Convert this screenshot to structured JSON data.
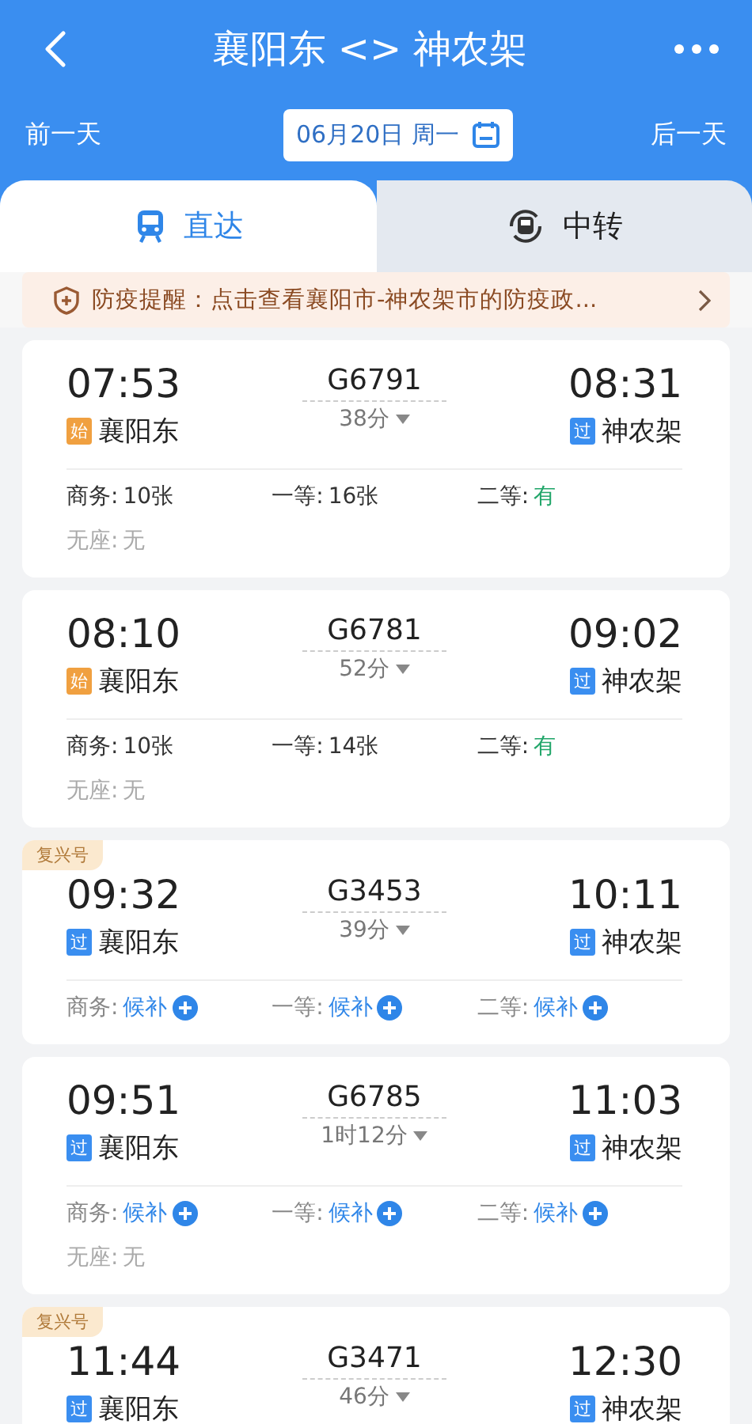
{
  "header": {
    "title": "襄阳东 <> 神农架",
    "prev_day": "前一天",
    "date": "06月20日 周一",
    "next_day": "后一天"
  },
  "tabs": [
    {
      "label": "直达",
      "kind": "direct",
      "selected": true
    },
    {
      "label": "中转",
      "kind": "transfer",
      "selected": false
    }
  ],
  "notice": {
    "text": "防疫提醒：点击查看襄阳市-神农架市的防疫政..."
  },
  "trains": [
    {
      "depart": {
        "time": "07:53",
        "mark": "始",
        "kind": "start",
        "station": "襄阳东"
      },
      "number": "G6791",
      "duration": "38分",
      "arrive": {
        "time": "08:31",
        "mark": "过",
        "kind": "pass",
        "station": "神农架"
      },
      "seats": [
        {
          "label": "商务:",
          "value": "10张",
          "kind": "count"
        },
        {
          "label": "一等:",
          "value": "16张",
          "kind": "count"
        },
        {
          "label": "二等:",
          "value": "有",
          "kind": "available"
        },
        {
          "label": "无座:",
          "value": "无",
          "kind": "none"
        }
      ]
    },
    {
      "depart": {
        "time": "08:10",
        "mark": "始",
        "kind": "start",
        "station": "襄阳东"
      },
      "number": "G6781",
      "duration": "52分",
      "arrive": {
        "time": "09:02",
        "mark": "过",
        "kind": "pass",
        "station": "神农架"
      },
      "seats": [
        {
          "label": "商务:",
          "value": "10张",
          "kind": "count"
        },
        {
          "label": "一等:",
          "value": "14张",
          "kind": "count"
        },
        {
          "label": "二等:",
          "value": "有",
          "kind": "available"
        },
        {
          "label": "无座:",
          "value": "无",
          "kind": "none"
        }
      ]
    },
    {
      "tag": "复兴号",
      "depart": {
        "time": "09:32",
        "mark": "过",
        "kind": "pass",
        "station": "襄阳东"
      },
      "number": "G3453",
      "duration": "39分",
      "arrive": {
        "time": "10:11",
        "mark": "过",
        "kind": "pass",
        "station": "神农架"
      },
      "seats": [
        {
          "label": "商务:",
          "value": "候补",
          "kind": "waitlist"
        },
        {
          "label": "一等:",
          "value": "候补",
          "kind": "waitlist"
        },
        {
          "label": "二等:",
          "value": "候补",
          "kind": "waitlist"
        }
      ]
    },
    {
      "depart": {
        "time": "09:51",
        "mark": "过",
        "kind": "pass",
        "station": "襄阳东"
      },
      "number": "G6785",
      "duration": "1时12分",
      "arrive": {
        "time": "11:03",
        "mark": "过",
        "kind": "pass",
        "station": "神农架"
      },
      "seats": [
        {
          "label": "商务:",
          "value": "候补",
          "kind": "waitlist"
        },
        {
          "label": "一等:",
          "value": "候补",
          "kind": "waitlist"
        },
        {
          "label": "二等:",
          "value": "候补",
          "kind": "waitlist"
        },
        {
          "label": "无座:",
          "value": "无",
          "kind": "none"
        }
      ]
    },
    {
      "tag": "复兴号",
      "depart": {
        "time": "11:44",
        "mark": "过",
        "kind": "pass",
        "station": "襄阳东"
      },
      "number": "G3471",
      "duration": "46分",
      "arrive": {
        "time": "12:30",
        "mark": "过",
        "kind": "pass",
        "station": "神农架"
      }
    }
  ]
}
